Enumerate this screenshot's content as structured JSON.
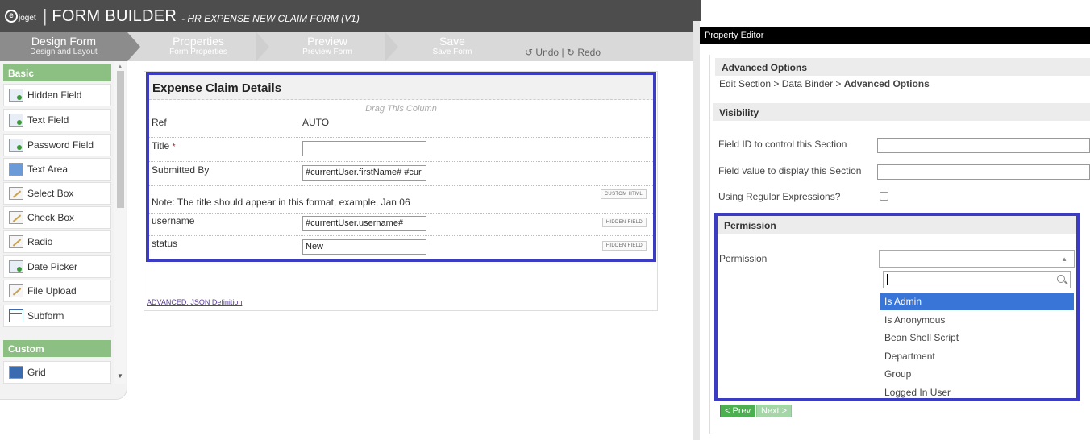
{
  "header": {
    "logo_text": "joget",
    "title": "FORM BUILDER",
    "subtitle": "- HR EXPENSE NEW CLAIM FORM (V1)"
  },
  "tabs": [
    {
      "label": "Design Form",
      "sub": "Design and Layout"
    },
    {
      "label": "Properties",
      "sub": "Form Properties"
    },
    {
      "label": "Preview",
      "sub": "Preview Form"
    },
    {
      "label": "Save",
      "sub": "Save Form"
    }
  ],
  "toolbar": {
    "undo": "Undo",
    "sep": "|",
    "redo": "Redo"
  },
  "palette": {
    "basic_label": "Basic",
    "items": [
      "Hidden Field",
      "Text Field",
      "Password Field",
      "Text Area",
      "Select Box",
      "Check Box",
      "Radio",
      "Date Picker",
      "File Upload",
      "Subform"
    ],
    "custom_label": "Custom",
    "custom_items": [
      "Grid"
    ]
  },
  "form": {
    "section_title": "Expense Claim Details",
    "drag_hint": "Drag This Column",
    "ref_label": "Ref",
    "ref_value": "AUTO",
    "title_label": "Title",
    "required_mark": "*",
    "title_value": "",
    "submitted_label": "Submitted By",
    "submitted_value": "#currentUser.firstName# #cur",
    "note": "Note: The title should appear in this format, example, Jan 06",
    "note_badge": "CUSTOM HTML",
    "username_label": "username",
    "username_value": "#currentUser.username#",
    "username_badge": "HIDDEN FIELD",
    "status_label": "status",
    "status_value": "New",
    "status_badge": "HIDDEN FIELD",
    "json_link": "ADVANCED: JSON Definition"
  },
  "property_editor": {
    "title": "Property Editor",
    "page_title": "Advanced Options",
    "breadcrumb_prefix": "Edit Section > Data Binder > ",
    "breadcrumb_current": "Advanced Options",
    "visibility_title": "Visibility",
    "field_id_label": "Field ID to control this Section",
    "field_value_label": "Field value to display this Section",
    "regex_label": "Using Regular Expressions?",
    "permission_title": "Permission",
    "permission_label": "Permission",
    "options": [
      "Is Admin",
      "Is Anonymous",
      "Bean Shell Script",
      "Department",
      "Group",
      "Logged In User"
    ],
    "prev_label": "< Prev",
    "next_label": "Next >"
  }
}
